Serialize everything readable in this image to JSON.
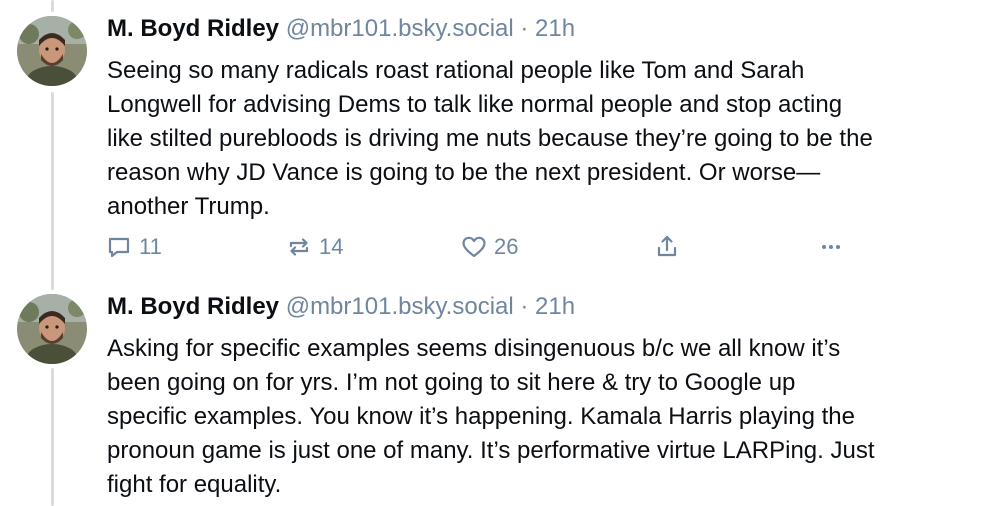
{
  "posts": [
    {
      "author": {
        "display_name": "M. Boyd Ridley",
        "handle": "@mbr101.bsky.social",
        "avatar": "avatar-photo"
      },
      "separator": "·",
      "time": "21h",
      "text_lines": [
        "Seeing so many radicals roast rational people like Tom and Sarah",
        "Longwell for advising Dems to talk like normal people and stop acting",
        "like stilted purebloods is driving me nuts because they’re going to be the",
        "reason why JD Vance is going to be the next president. Or worse—",
        "another Trump."
      ],
      "actions": {
        "reply_count": "11",
        "repost_count": "14",
        "like_count": "26",
        "reply_icon": "reply-bubble-icon",
        "repost_icon": "repost-arrows-icon",
        "like_icon": "heart-icon",
        "share_icon": "share-icon",
        "more_icon": "more-dots-icon"
      }
    },
    {
      "author": {
        "display_name": "M. Boyd Ridley",
        "handle": "@mbr101.bsky.social",
        "avatar": "avatar-photo"
      },
      "separator": "·",
      "time": "21h",
      "text_lines": [
        "Asking for specific examples seems disingenuous b/c we all know it’s",
        "been going on for yrs. I’m not going to sit here & try to Google up",
        "specific examples. You know it’s happening. Kamala Harris playing the",
        "pronoun game is just one of many. It’s performative virtue LARPing. Just",
        "fight for equality."
      ]
    }
  ],
  "colors": {
    "text": "#0b0f14",
    "muted": "#6f869f",
    "thread_line": "#d4dbe2",
    "background": "#ffffff"
  }
}
